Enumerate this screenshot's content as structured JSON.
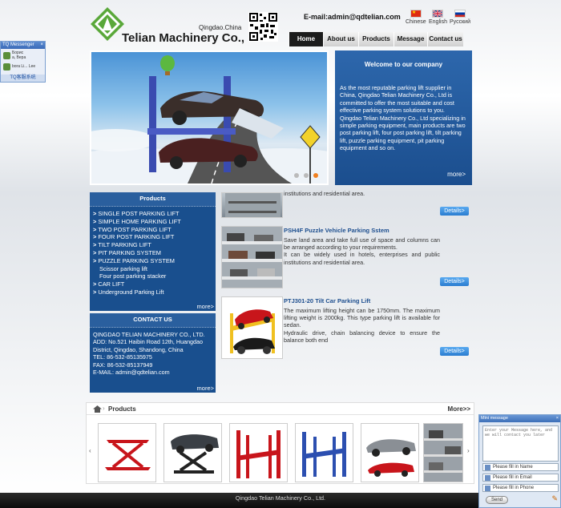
{
  "header": {
    "city": "Qingdao.China",
    "company": "Telian Machinery Co., Ltd.",
    "email": "E-mail:admin@qdtelian.com",
    "languages": [
      {
        "label": "Chinese",
        "icon": "china-flag-icon"
      },
      {
        "label": "English",
        "icon": "uk-flag-icon"
      },
      {
        "label": "Русский",
        "icon": "russia-flag-icon"
      }
    ],
    "nav": [
      "Home",
      "About us",
      "Products",
      "Message",
      "Contact us"
    ]
  },
  "tq": {
    "title": "TQ Messenger",
    "close": "×",
    "contacts": [
      "Борис\nа, Вера",
      "bora Li... Lee"
    ],
    "footer": "TQ客服系统"
  },
  "welcome": {
    "title": "Welcome to our company",
    "text": "As the most reputable parking lift supplier in China, Qingdao Telian Machinery Co., Ltd is committed to offer the most suitable and cost effective parking system solutions to you.\nQingdao Telian Machinery Co., Ltd specializing in simple parking equipment, main products are two post parking lift, four post parking lift, tilt parking lift, puzzle parking equipment, pit parking equipment and so on.",
    "more": "more>"
  },
  "products_box": {
    "title": "Products",
    "items": [
      {
        "label": "SINGLE POST PARKING LIFT",
        "sub": false
      },
      {
        "label": "SIMPLE HOME PARKING LIFT",
        "sub": false
      },
      {
        "label": "TWO POST PARKING LIFT",
        "sub": false
      },
      {
        "label": "FOUR POST PARKING LIFT",
        "sub": false
      },
      {
        "label": "TILT PARKING LIFT",
        "sub": false
      },
      {
        "label": "PIT PARKING SYSTEM",
        "sub": false
      },
      {
        "label": "PUZZLE PARKING SYSTEM",
        "sub": false
      },
      {
        "label": "Scissor parking lift",
        "sub": true
      },
      {
        "label": "Four post parking stacker",
        "sub": true
      },
      {
        "label": "CAR LIFT",
        "sub": false
      },
      {
        "label": "Underground Parking Lift",
        "sub": false
      }
    ],
    "more": "more>"
  },
  "contact_box": {
    "title": "CONTACT US",
    "lines": [
      "QINGDAO TELIAN MACHINERY CO., LTD.",
      "ADD: No.521 Haibin Road 12th, Huangdao",
      "District, Qingdao, Shandong, China",
      "TEL: 86-532-85135975",
      "FAX: 86-532-85137949",
      "E-MAIL: admin@qdtelian.com"
    ],
    "more": "more>"
  },
  "product_list": [
    {
      "title": "",
      "desc": "institutions and residential area.",
      "details": "Details>"
    },
    {
      "title": "PSH4F Puzzle Vehicle Parking Sstem",
      "desc": "Save land area and take full use of space and columns can be arranged according to your requirements.\nIt can be widely used in hotels, enterprises and public institutions and residential area.",
      "details": "Details>"
    },
    {
      "title": "PTJ301-20 Tilt Car Parking Lift",
      "desc": "The maximum lifting height can be 1750mm. The maximum lifting weight is 2000kg. This type parking lift is available for sedan.\nHydraulic drive, chain balancing device to ensure the balance both end",
      "details": "Details>"
    }
  ],
  "strip": {
    "title": "Products",
    "more": "More>>",
    "prev": "‹",
    "next": "›"
  },
  "footer": {
    "text": "Qingdao Telian Machinery Co., Ltd."
  },
  "mini": {
    "title": "Mini message",
    "close": "×",
    "placeholder": "Enter your Message here, and we will contact you later",
    "name": "Please fill in Name",
    "email": "Please fill in Email",
    "phone": "Please fill in Phone",
    "send": "Send"
  }
}
